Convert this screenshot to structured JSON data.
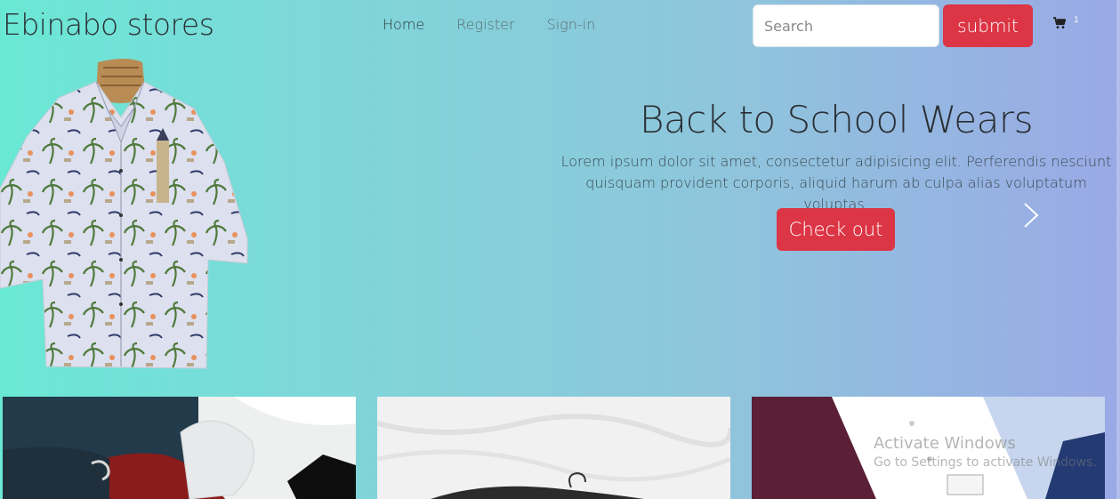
{
  "header": {
    "brand": "Ebinabo stores",
    "nav": [
      {
        "label": "Home"
      },
      {
        "label": "Register"
      },
      {
        "label": "Sign-in"
      }
    ],
    "search_placeholder": "Search",
    "search_value": "",
    "submit_label": "submit",
    "cart_icon": "cart-icon",
    "cart_count": "1"
  },
  "hero": {
    "title": "Back to School Wears",
    "text": "Lorem ipsum dolor sit amet, consectetur adipisicing elit. Perferendis nesciunt quisquam provident corporis, aliquid harum ab culpa alias voluptatum voluptas.",
    "cta_label": "Check out",
    "next_icon": "chevron-right-icon"
  },
  "colors": {
    "accent": "#dc3545",
    "gradient_start": "#6ae8d6",
    "gradient_end": "#9aa9e6"
  },
  "watermark": {
    "title": "Activate Windows",
    "subtitle": "Go to Settings to activate Windows."
  }
}
